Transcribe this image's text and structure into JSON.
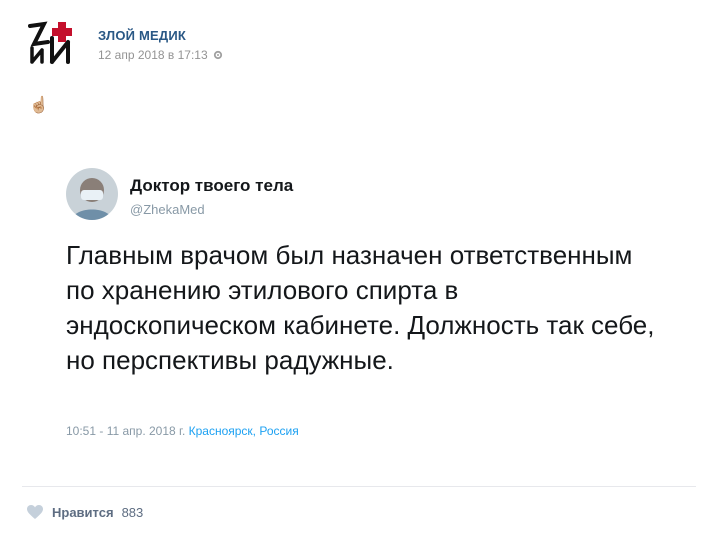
{
  "post": {
    "author": "ЗЛОЙ МЕДИК",
    "date": "12 апр 2018 в 17:13",
    "emoji": "☝🏼"
  },
  "tweet": {
    "name": "Доктор твоего тела",
    "handle": "@ZhekaMed",
    "text": "Главным врачом был назначен ответственным по хранению этилового спирта в эндоскопическом кабинете. Должность так себе, но перспективы радужные.",
    "meta": "10:51 - 11 апр. 2018 г.",
    "location": "Красноярск, Россия"
  },
  "footer": {
    "like_label": "Нравится",
    "like_count": "883"
  },
  "colors": {
    "link": "#2a5885",
    "muted": "#939393",
    "twitter_blue": "#1da1f2",
    "logo_red": "#c4102c"
  }
}
